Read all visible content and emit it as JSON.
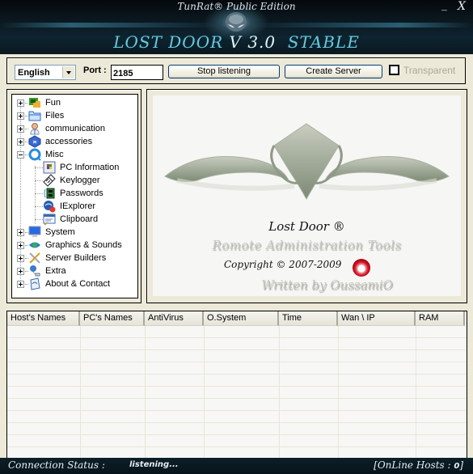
{
  "window": {
    "subtitle": "TunRat® Public Edition",
    "title_main": "LOST DOOR ",
    "title_version": "V 3.0",
    "title_suffix": "  STABLE",
    "minimize_label": "_",
    "close_label": "X"
  },
  "toolbar": {
    "language": "English",
    "port_label": "Port :",
    "port_value": "2185",
    "stop_button": "Stop listening",
    "create_button": "Create Server",
    "transparent_label": "Transparent",
    "transparent_checked": false
  },
  "tree": {
    "items": [
      {
        "label": "Fun",
        "icon": "games-icon",
        "expander": "plus",
        "level": 0
      },
      {
        "label": "Files",
        "icon": "folder-icon",
        "expander": "plus",
        "level": 0
      },
      {
        "label": "communication",
        "icon": "user-chat-icon",
        "expander": "plus",
        "level": 0
      },
      {
        "label": "accessories",
        "icon": "accessories-icon",
        "expander": "plus",
        "level": 0
      },
      {
        "label": "Misc",
        "icon": "misc-icon",
        "expander": "minus",
        "level": 0
      },
      {
        "label": "PC Information",
        "icon": "pc-info-icon",
        "level": 1
      },
      {
        "label": "Keylogger",
        "icon": "keylogger-icon",
        "level": 1
      },
      {
        "label": "Passwords",
        "icon": "passwords-icon",
        "level": 1
      },
      {
        "label": "IExplorer",
        "icon": "iexplorer-icon",
        "level": 1
      },
      {
        "label": "Clipboard",
        "icon": "clipboard-icon",
        "level": 1
      },
      {
        "label": "System",
        "icon": "monitor-icon",
        "expander": "plus",
        "level": 0
      },
      {
        "label": "Graphics & Sounds",
        "icon": "graphics-icon",
        "expander": "plus",
        "level": 0
      },
      {
        "label": "Server Builders",
        "icon": "tools-icon",
        "expander": "plus",
        "level": 0
      },
      {
        "label": "Extra",
        "icon": "extra-icon",
        "expander": "plus",
        "level": 0
      },
      {
        "label": "About & Contact",
        "icon": "about-icon",
        "expander": "plus",
        "level": 0
      }
    ]
  },
  "logo": {
    "name": "Lost Door ®",
    "subtitle": "Romote Administration Tools",
    "copyright": "Copyright © 2007-2009",
    "author": "Written by OussamiO"
  },
  "hosts_table": {
    "columns": [
      "Host's Names",
      "PC's Names",
      "AntiVirus",
      "O.System",
      "Time",
      "Wan \\ IP",
      "RAM"
    ],
    "rows": []
  },
  "status": {
    "connection_label": "Connection Status :",
    "connection_value": "listening...",
    "online_prefix": "[OnLine Hosts : ",
    "online_count": "0",
    "online_suffix": "]"
  },
  "colors": {
    "accent": "#6cc8dc",
    "panel_bg": "#ece9d8",
    "header_bg": "#0b1820"
  }
}
